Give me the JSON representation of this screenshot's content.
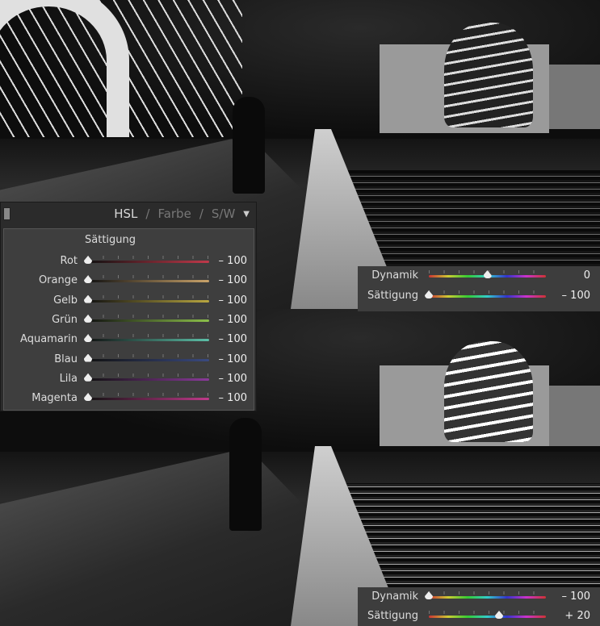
{
  "hsl_panel": {
    "tabs": [
      "HSL",
      "/",
      "Farbe",
      "/",
      "S/W"
    ],
    "section": "Sättigung",
    "sliders": [
      {
        "label": "Rot",
        "value": "– 100",
        "fraction": 0,
        "color": "#c0394a"
      },
      {
        "label": "Orange",
        "value": "– 100",
        "fraction": 0,
        "color": "#c9a36a"
      },
      {
        "label": "Gelb",
        "value": "– 100",
        "fraction": 0,
        "color": "#b8a640"
      },
      {
        "label": "Grün",
        "value": "– 100",
        "fraction": 0,
        "color": "#8cc04a"
      },
      {
        "label": "Aquamarin",
        "value": "– 100",
        "fraction": 0,
        "color": "#5cc0a8"
      },
      {
        "label": "Blau",
        "value": "– 100",
        "fraction": 0,
        "color": "#3a4a80"
      },
      {
        "label": "Lila",
        "value": "– 100",
        "fraction": 0,
        "color": "#8a3a9a"
      },
      {
        "label": "Magenta",
        "value": "– 100",
        "fraction": 0,
        "color": "#c03a8a"
      }
    ]
  },
  "presence_top": {
    "sliders": [
      {
        "label": "Dynamik",
        "value": "0",
        "fraction": 0.5
      },
      {
        "label": "Sättigung",
        "value": "– 100",
        "fraction": 0
      }
    ]
  },
  "presence_bottom": {
    "sliders": [
      {
        "label": "Dynamik",
        "value": "– 100",
        "fraction": 0
      },
      {
        "label": "Sättigung",
        "value": "+ 20",
        "fraction": 0.6
      }
    ]
  }
}
